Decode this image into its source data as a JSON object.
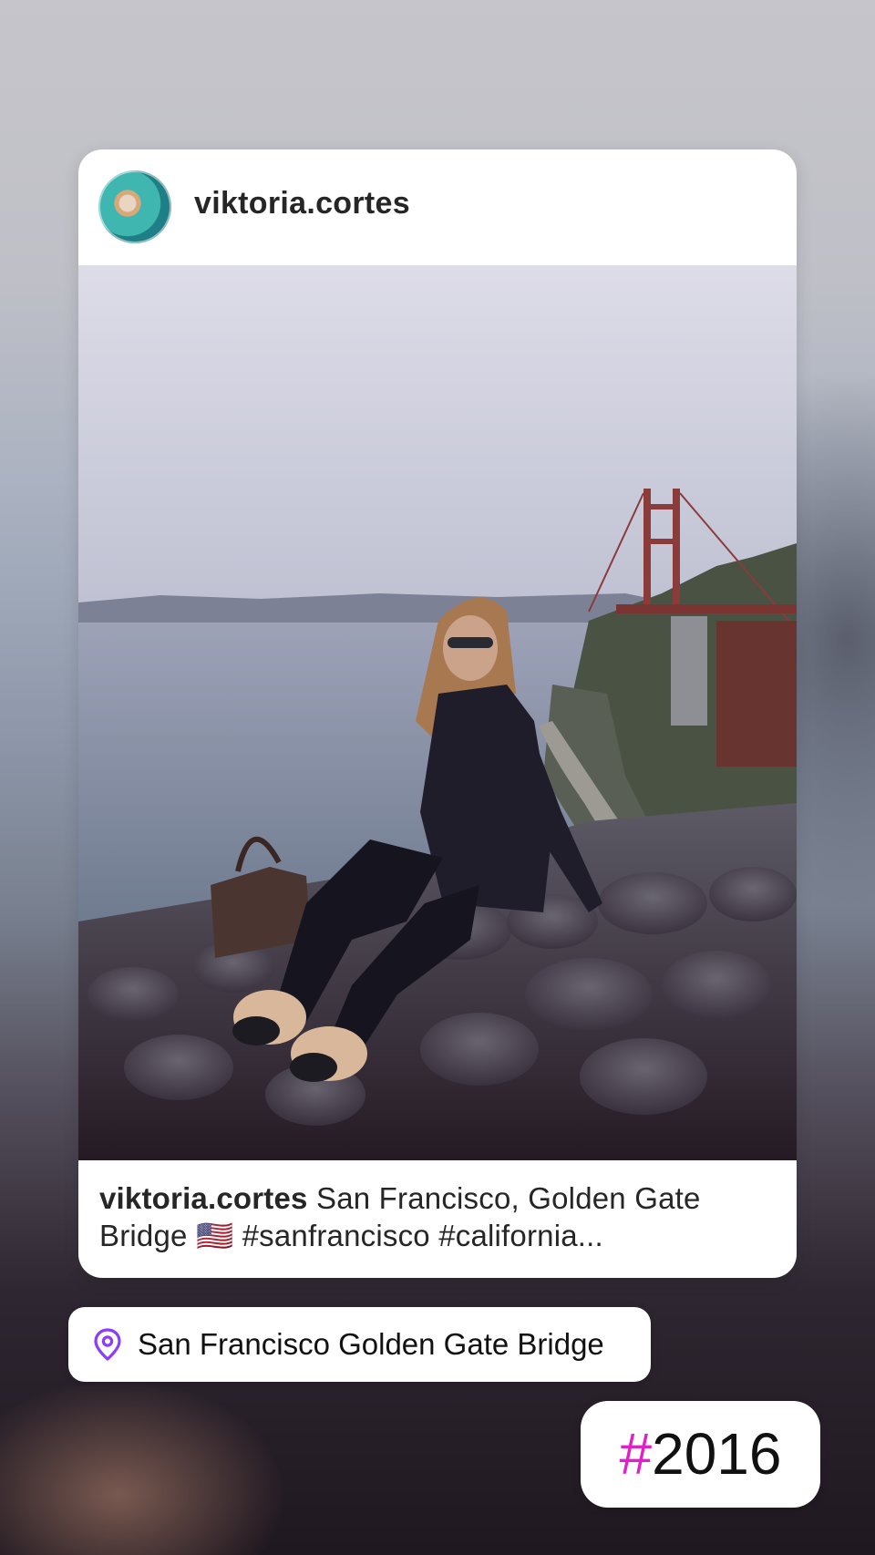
{
  "post": {
    "username": "viktoria.cortes",
    "caption_user": "viktoria.cortes",
    "caption_text": " San Francisco, Golden Gate Bridge 🇺🇸 #sanfrancisco #california..."
  },
  "location_sticker": {
    "icon": "location-pin-icon",
    "text": "San Francisco Golden Gate Bridge",
    "icon_color": "#8b3dff"
  },
  "hashtag_sticker": {
    "hash": "#",
    "text": "2016",
    "hash_color": "#e020c8"
  }
}
